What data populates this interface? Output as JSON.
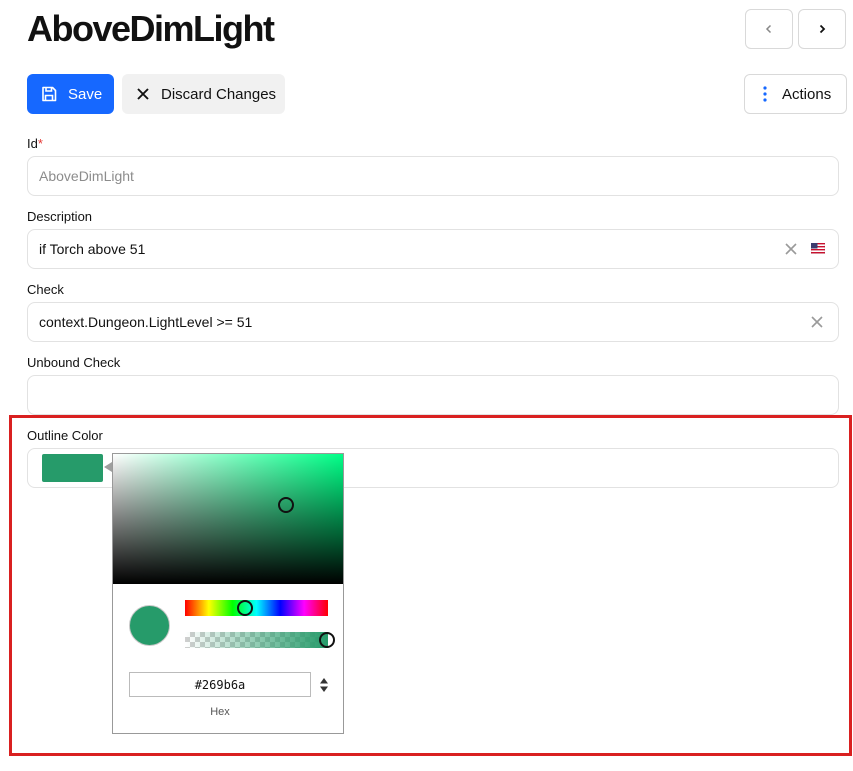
{
  "header": {
    "title": "AboveDimLight"
  },
  "nav": {
    "prev_icon": "chevron-left-icon",
    "next_icon": "chevron-right-icon"
  },
  "toolbar": {
    "save_label": "Save",
    "discard_label": "Discard Changes",
    "actions_label": "Actions"
  },
  "form": {
    "id": {
      "label": "Id",
      "required_mark": "*",
      "value": "AboveDimLight"
    },
    "description": {
      "label": "Description",
      "value": "if Torch above 51"
    },
    "check": {
      "label": "Check",
      "value": "context.Dungeon.LightLevel >= 51"
    },
    "unbound_check": {
      "label": "Unbound Check",
      "value": ""
    },
    "outline_color": {
      "label": "Outline Color",
      "value": "#269b6a"
    }
  },
  "color_picker": {
    "hex_value": "#269b6a",
    "format_label": "Hex",
    "alpha": 1.0
  },
  "colors": {
    "accent": "#1668ff",
    "selected_color": "#269b6a",
    "highlight_border": "#d92020"
  }
}
